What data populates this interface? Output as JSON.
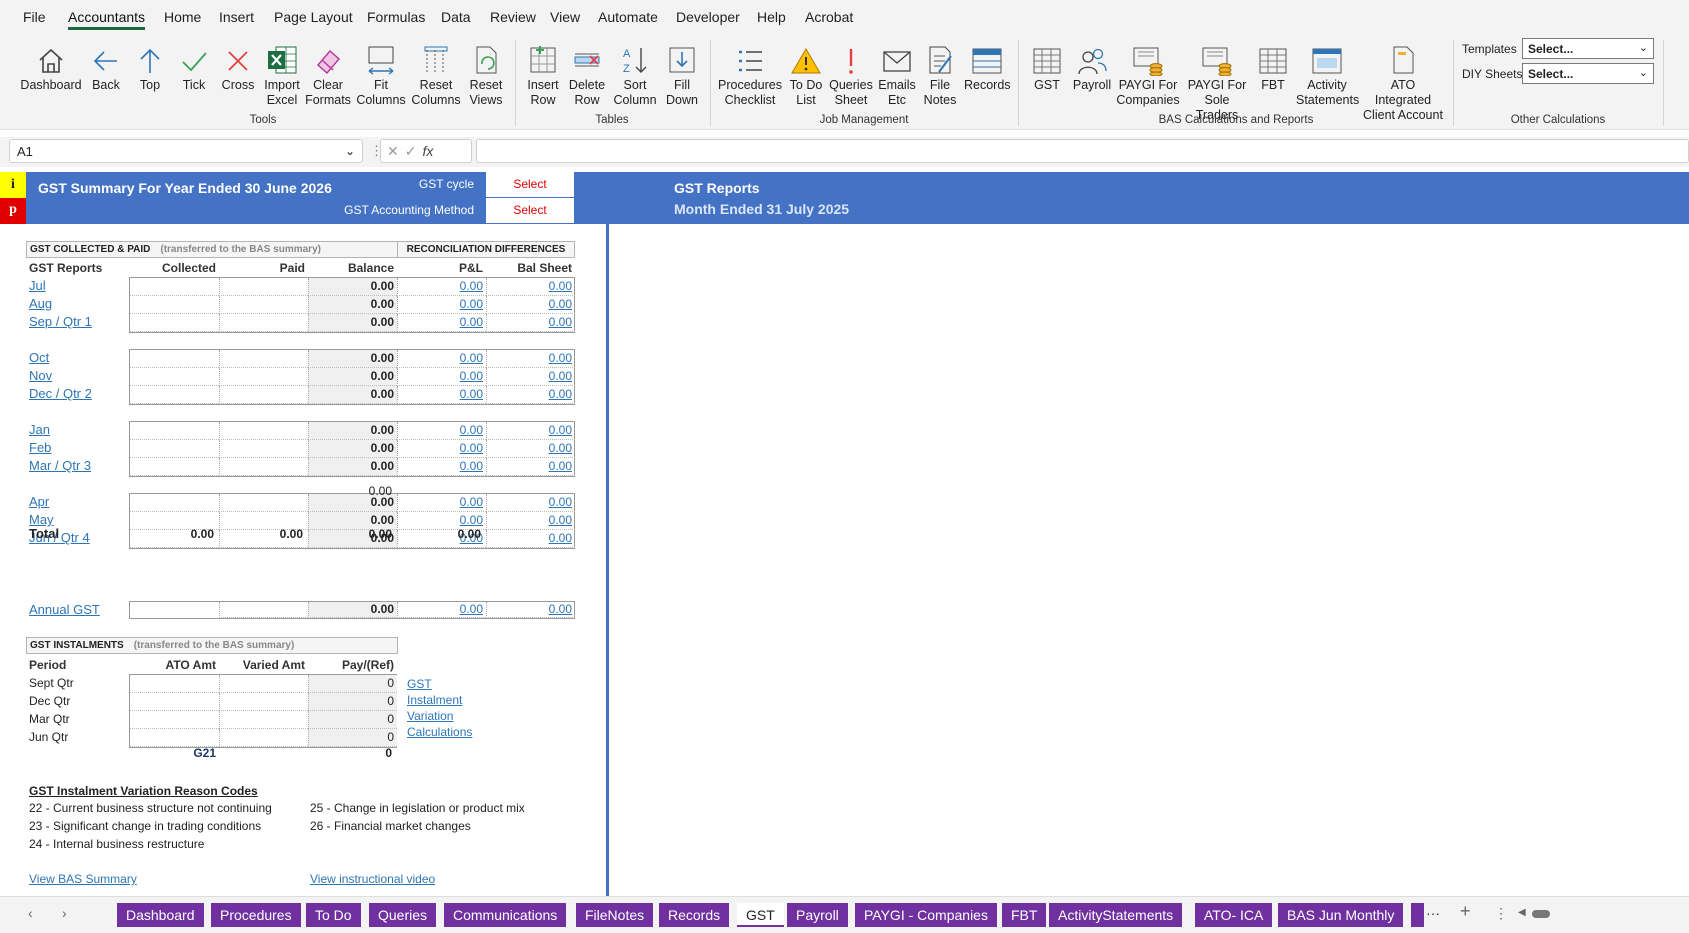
{
  "menu": [
    "File",
    "Accountants",
    "Home",
    "Insert",
    "Page Layout",
    "Formulas",
    "Data",
    "Review",
    "View",
    "Automate",
    "Developer",
    "Help",
    "Acrobat"
  ],
  "ribbon": {
    "tools": [
      "Dashboard",
      "Back",
      "Top",
      "Tick",
      "Cross",
      "Import\nExcel",
      "Clear\nFormats",
      "Fit\nColumns",
      "Reset\nColumns",
      "Reset\nViews"
    ],
    "tables": [
      "Insert\nRow",
      "Delete\nRow",
      "Sort\nColumn",
      "Fill\nDown"
    ],
    "job": [
      "Procedures\nChecklist",
      "To Do\nList",
      "Queries\nSheet",
      "Emails\nEtc",
      "File\nNotes",
      "Records"
    ],
    "bas": [
      "GST",
      "Payroll",
      "PAYGI For\nCompanies",
      "PAYGI For\nSole Traders",
      "FBT",
      "Activity\nStatements",
      "ATO Integrated\nClient Account"
    ],
    "groups": [
      "Tools",
      "Tables",
      "Job Management",
      "BAS Calculations and Reports",
      "Other Calculations"
    ],
    "other": {
      "templates_label": "Templates",
      "templates_value": "Select...",
      "diy_label": "DIY Sheets",
      "diy_value": "Select..."
    }
  },
  "formula_bar": {
    "cell_ref": "A1",
    "fx": "fx",
    "content": ""
  },
  "sheet": {
    "info_icon": "i",
    "p_icon": "p",
    "title": "GST Summary For Year Ended 30 June 2026",
    "gst_cycle_label": "GST cycle",
    "gst_cycle_value": "Select",
    "method_label": "GST Accounting Method",
    "method_value": "Select",
    "reports_title": "GST Reports",
    "reports_subtitle": "Month Ended 31 July 2025",
    "collected_header": "GST COLLECTED & PAID",
    "collected_note": "(transferred to the BAS summary)",
    "recon_header": "RECONCILIATION DIFFERENCES",
    "col_heads": [
      "GST Reports",
      "Collected",
      "Paid",
      "Balance",
      "P&L",
      "Bal Sheet"
    ],
    "months": [
      {
        "name": "Jul",
        "bal": "0.00",
        "pl": "0.00",
        "bs": "0.00"
      },
      {
        "name": "Aug",
        "bal": "0.00",
        "pl": "0.00",
        "bs": "0.00"
      },
      {
        "name": "Sep / Qtr 1",
        "bal": "0.00",
        "pl": "0.00",
        "bs": "0.00"
      },
      {
        "name": "Oct",
        "bal": "0.00",
        "pl": "0.00",
        "bs": "0.00"
      },
      {
        "name": "Nov",
        "bal": "0.00",
        "pl": "0.00",
        "bs": "0.00"
      },
      {
        "name": "Dec / Qtr 2",
        "bal": "0.00",
        "pl": "0.00",
        "bs": "0.00"
      },
      {
        "name": "Jan",
        "bal": "0.00",
        "pl": "0.00",
        "bs": "0.00"
      },
      {
        "name": "Feb",
        "bal": "0.00",
        "pl": "0.00",
        "bs": "0.00"
      },
      {
        "name": "Mar / Qtr 3",
        "bal": "0.00",
        "pl": "0.00",
        "bs": "0.00"
      },
      {
        "name": "Apr",
        "bal": "0.00",
        "pl": "0.00",
        "bs": "0.00"
      },
      {
        "name": "May",
        "bal": "0.00",
        "pl": "0.00",
        "bs": "0.00"
      },
      {
        "name": "Jun / Qtr 4",
        "bal": "0.00",
        "pl": "0.00",
        "bs": "0.00"
      }
    ],
    "q3_subtotal": "0.00",
    "total_label": "Total",
    "totals": [
      "0.00",
      "0.00",
      "0.00",
      "0.00"
    ],
    "annual_label": "Annual GST",
    "annual": {
      "bal": "0.00",
      "pl": "0.00",
      "bs": "0.00"
    },
    "inst_header": "GST INSTALMENTS",
    "inst_note": "(transferred to the BAS summary)",
    "inst_heads": [
      "Period",
      "ATO Amt",
      "Varied Amt",
      "Pay/(Ref)"
    ],
    "inst_rows": [
      {
        "p": "Sept Qtr",
        "v": "0"
      },
      {
        "p": "Dec Qtr",
        "v": "0"
      },
      {
        "p": "Mar Qtr",
        "v": "0"
      },
      {
        "p": "Jun Qtr",
        "v": "0"
      }
    ],
    "g21_label": "G21",
    "g21_value": "0",
    "variation_link": [
      "GST ",
      "Instalment ",
      "Variation ",
      "Calculations"
    ],
    "codes_title": "GST Instalment Variation Reason Codes",
    "codes_left": [
      "22 - Current business structure not continuing",
      "23 - Significant change in trading conditions",
      "24 - Internal business restructure"
    ],
    "codes_right": [
      "25 - Change in legislation or product mix",
      "26 - Financial market changes"
    ],
    "bas_link": "View BAS Summary",
    "video_link": "View instructional video"
  },
  "tabs": [
    "Dashboard",
    "Procedures",
    "To Do",
    "Queries",
    "Communications",
    "FileNotes",
    "Records",
    "GST",
    "Payroll",
    "PAYGI - Companies",
    "FBT",
    "ActivityStatements",
    "ATO- ICA",
    "BAS Jun Monthly"
  ],
  "active_tab": "GST",
  "colors": {
    "accent": "#4472c4",
    "tab": "#7030a0",
    "link": "#2e75b6",
    "select": "#e00000"
  }
}
